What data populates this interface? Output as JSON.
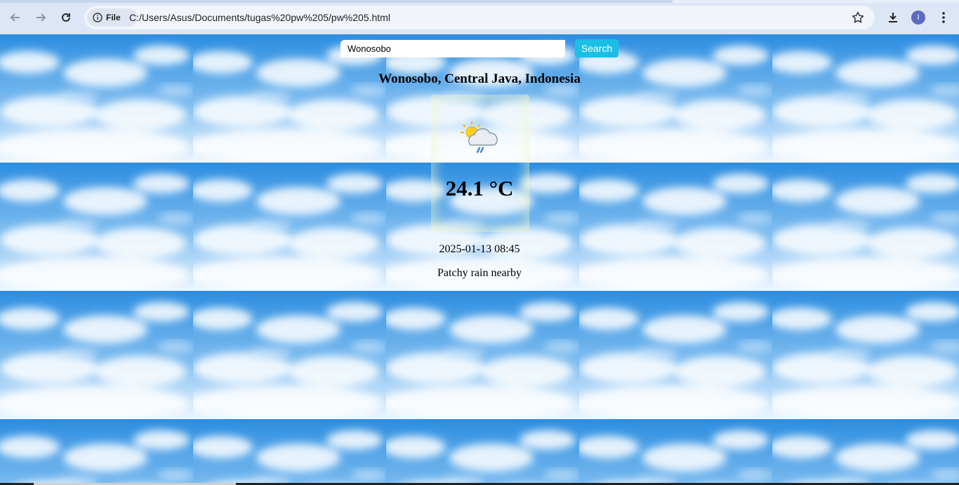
{
  "browser": {
    "site_chip_label": "File",
    "url": "C:/Users/Asus/Documents/tugas%20pw%205/pw%205.html",
    "profile_initial": "I"
  },
  "search": {
    "value": "Wonosobo",
    "button_label": "Search"
  },
  "weather": {
    "location": "Wonosobo, Central Java, Indonesia",
    "icon": "patchy-rain-icon",
    "temperature": "24.1 °C",
    "datetime": "2025-01-13 08:45",
    "condition": "Patchy rain nearby"
  },
  "colors": {
    "search_button": "#1bbfe6",
    "avatar": "#5c6bc0"
  }
}
